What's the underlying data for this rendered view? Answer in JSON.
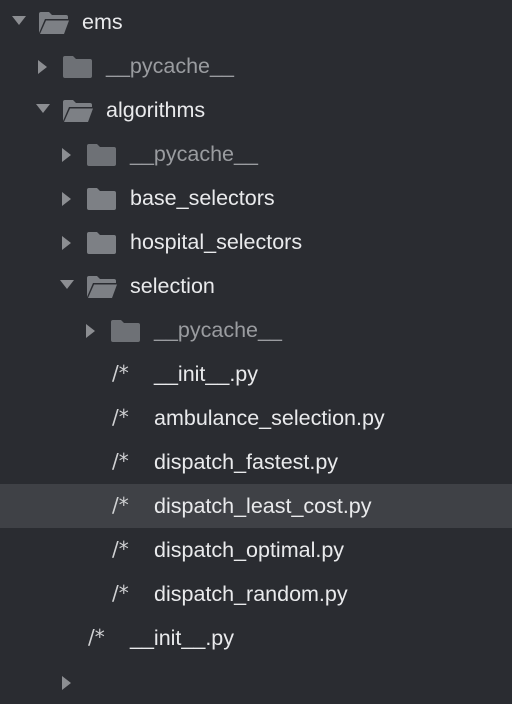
{
  "tree": {
    "ems": {
      "label": "ems",
      "icon": "folder-open-icon"
    },
    "ems_pycache": {
      "label": "__pycache__",
      "icon": "folder-icon"
    },
    "algorithms": {
      "label": "algorithms",
      "icon": "folder-open-icon"
    },
    "alg_pycache": {
      "label": "__pycache__",
      "icon": "folder-icon"
    },
    "base_selectors": {
      "label": "base_selectors",
      "icon": "folder-icon"
    },
    "hospital_selectors": {
      "label": "hospital_selectors",
      "icon": "folder-icon"
    },
    "selection": {
      "label": "selection",
      "icon": "folder-open-icon"
    },
    "sel_pycache": {
      "label": "__pycache__",
      "icon": "folder-icon"
    },
    "files": [
      {
        "label": "__init__.py",
        "icon": "/*"
      },
      {
        "label": "ambulance_selection.py",
        "icon": "/*"
      },
      {
        "label": "dispatch_fastest.py",
        "icon": "/*"
      },
      {
        "label": "dispatch_least_cost.py",
        "icon": "/*",
        "selected": true
      },
      {
        "label": "dispatch_optimal.py",
        "icon": "/*"
      },
      {
        "label": "dispatch_random.py",
        "icon": "/*"
      }
    ],
    "alg_init": {
      "label": "__init__.py",
      "icon": "/*"
    }
  },
  "colors": {
    "background": "#2a2c31",
    "selected_row": "#3f4146",
    "text": "#e9eaec",
    "dim_text": "#9a9ca0",
    "folder": "#7d8085",
    "chevron": "#8c8e92"
  }
}
